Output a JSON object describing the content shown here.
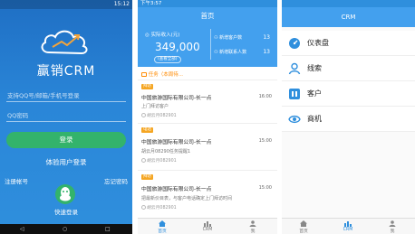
{
  "login": {
    "status_left": "",
    "status_time": "15:12",
    "brand": "赢销CRM",
    "account_placeholder": "支持QQ号/邮箱/手机号登录",
    "password_placeholder": "QQ密码",
    "login_button": "登录",
    "experience_login": "体验用户登录",
    "register": "注册帐号",
    "forgot": "忘记密码",
    "quick_login": "快速登录",
    "nav": [
      "◁",
      "○",
      "□"
    ]
  },
  "home": {
    "status_time": "下午3:57",
    "title": "首页",
    "sales_label": "实际收入(元)",
    "sales_value": "349,000",
    "sales_more": "(查看全部)",
    "stats": [
      {
        "label": "新增客户数",
        "value": "13"
      },
      {
        "label": "新增联系人数",
        "value": "13"
      }
    ],
    "task_header": "任务（本周待...",
    "cards": [
      {
        "tag": "拜访",
        "title": "中国旅游国际有限公司-长一点",
        "time": "16:00",
        "desc": "上门拜访客户",
        "user": "胡云月082901"
      },
      {
        "tag": "电话",
        "title": "中国旅游国际有限公司-长一点",
        "time": "15:00",
        "desc": "胡云月08290任务提醒1",
        "user": "胡云月082901"
      },
      {
        "tag": "拜访",
        "title": "中国旅游国际有限公司-长一点",
        "time": "15:00",
        "desc": "把最新价目表，与客户电话确定上门拜访时间",
        "user": "胡云月082901"
      }
    ],
    "tabs": [
      "首页",
      "CRM",
      "我"
    ]
  },
  "crm": {
    "title": "CRM",
    "menu": [
      {
        "label": "仪表盘",
        "icon": "dashboard-icon"
      },
      {
        "label": "线索",
        "icon": "lead-icon"
      },
      {
        "label": "客户",
        "icon": "customer-icon"
      },
      {
        "label": "商机",
        "icon": "opportunity-icon"
      }
    ],
    "tabs": [
      "首页",
      "CRM",
      "我"
    ]
  },
  "colors": {
    "brand_blue": "#2f8fdd",
    "login_green": "#33b36b",
    "task_orange": "#ff8a00",
    "tag_orange": "#f5a623"
  }
}
